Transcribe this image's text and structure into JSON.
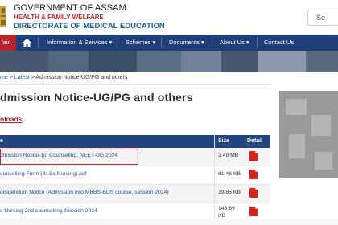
{
  "header": {
    "gov_title": "GOVERNMENT OF ASSAM",
    "dept": "HEALTH & FAMILY WELFARE",
    "directorate": "DIRECTORATE OF MEDICAL EDUCATION",
    "search_label": "Se"
  },
  "nav": {
    "main_label": "lain",
    "items": [
      "Information & Services ▾",
      "Schemes ▾",
      "Documents ▾",
      "About Us ▾",
      "Contact Us"
    ]
  },
  "breadcrumb": {
    "home": "me",
    "sep1": " > ",
    "latest": "Latest",
    "sep2": " > ",
    "current": "Admission Notice-UG/PG and others"
  },
  "page": {
    "title": "dmission Notice-UG/PG and others",
    "downloads_label": "nloads"
  },
  "table": {
    "headers": {
      "name": "e",
      "size": "Size",
      "detail": "Detail"
    },
    "rows": [
      {
        "name": "dmission Notice-1st Counseling, NEET-UG,2024",
        "size": "2.49 MB"
      },
      {
        "name": "ounselling Form (B. Sc Nursing).pdf",
        "size": "61.46 KB"
      },
      {
        "name": "orrigendum Notice (Admission into MBBS-BDS course, session 2024)",
        "size": "19.85 KB"
      },
      {
        "name": "c Nursing 2nd counselling Session 2024",
        "size_line1": "143.69",
        "size_line2": "KB"
      }
    ]
  },
  "colors": {
    "nav_bg": "#1e3f7a",
    "accent_red": "#b8232a",
    "link_blue": "#1f4f99",
    "highlight": "#d81f26"
  }
}
